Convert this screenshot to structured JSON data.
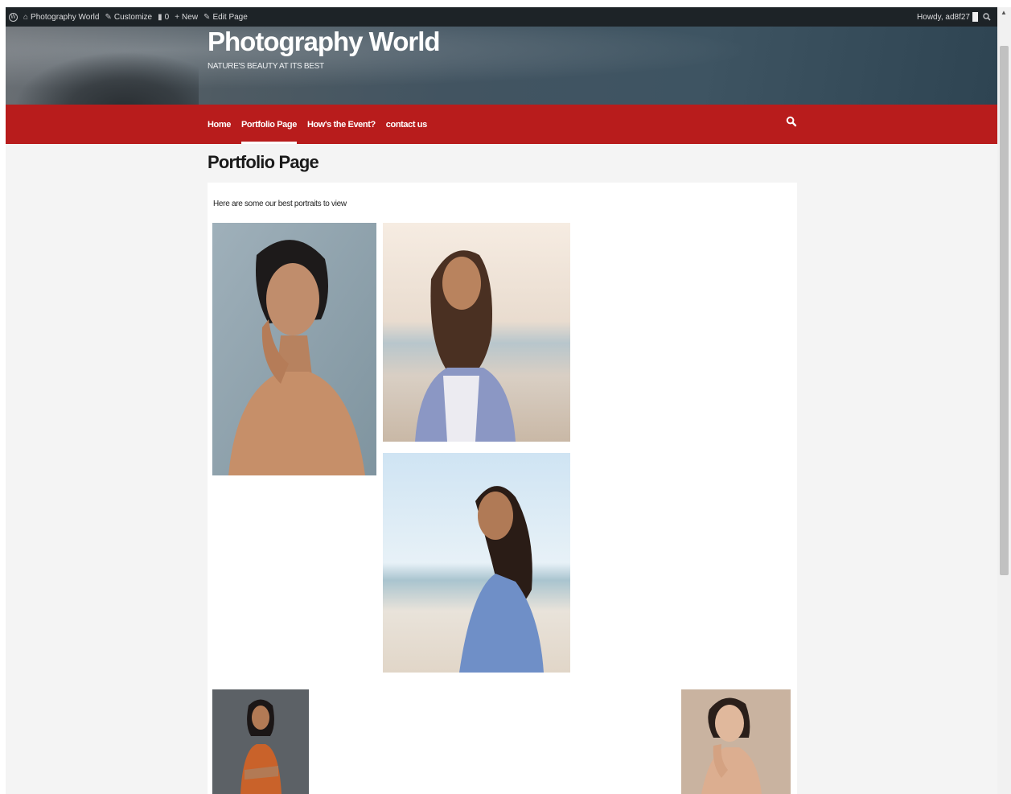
{
  "admin_bar": {
    "site_name": "Photography World",
    "customize": "Customize",
    "comments_count": "0",
    "new_label": "New",
    "edit_page": "Edit Page",
    "greeting": "Howdy, ad8f27",
    "icons": [
      "wordpress-logo-icon",
      "home-icon",
      "pencil-icon",
      "comment-icon",
      "plus-icon",
      "pencil-icon",
      "search-icon"
    ]
  },
  "header": {
    "site_title": "Photography World",
    "tagline": "NATURE'S BEAUTY AT ITS BEST"
  },
  "nav": {
    "items": [
      {
        "label": "Home",
        "active": false
      },
      {
        "label": "Portfolio Page",
        "active": true
      },
      {
        "label": "How's the Event?",
        "active": false
      },
      {
        "label": "contact us",
        "active": false
      }
    ]
  },
  "page": {
    "title": "Portfolio Page",
    "intro": "Here are some our best portraits to view"
  },
  "colors": {
    "accent_red": "#b81c1c",
    "admin_bar": "#1d2327",
    "page_bg": "#f4f4f4"
  }
}
